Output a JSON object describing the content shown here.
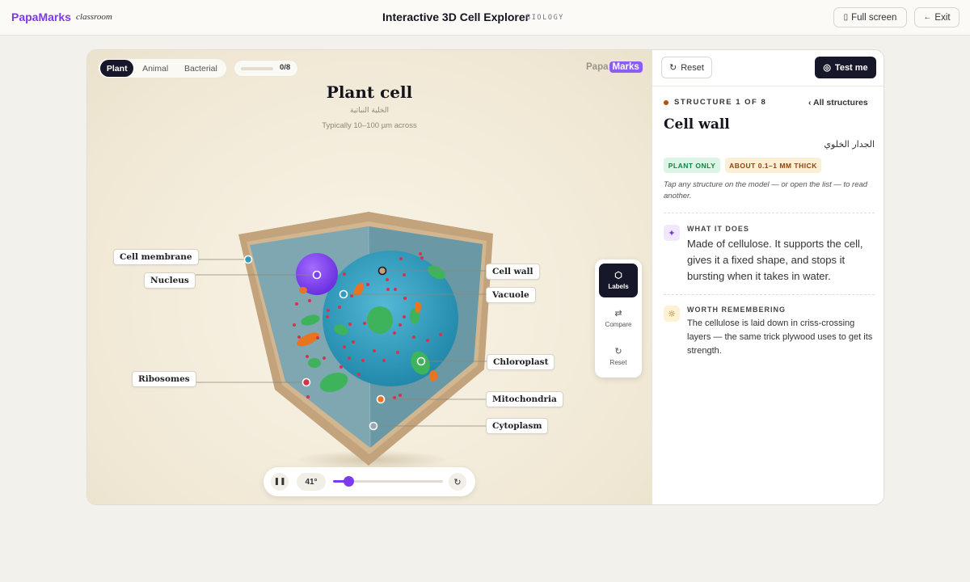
{
  "topbar": {
    "brand": "PapaMarks",
    "brand_sub": "classroom",
    "title": "Interactive 3D Cell Explorer",
    "subject": "BIOLOGY",
    "fullscreen_label": "Full screen",
    "exit_label": "Exit"
  },
  "viewer": {
    "tabs": [
      {
        "label": "Plant",
        "active": true
      },
      {
        "label": "Animal",
        "active": false
      },
      {
        "label": "Bacterial",
        "active": false
      }
    ],
    "progress": {
      "explored": 0,
      "total": 8,
      "text": "0/8"
    },
    "logo_left": "Papa",
    "logo_right": "Marks",
    "cell_title": "Plant cell",
    "cell_title_ar": "الخلية النباتية",
    "cell_size": "Typically 10–100 µm across",
    "labels": {
      "cell_membrane": "Cell membrane",
      "nucleus": "Nucleus",
      "ribosomes": "Ribosomes",
      "cell_wall": "Cell wall",
      "vacuole": "Vacuole",
      "chloroplast": "Chloroplast",
      "mitochondria": "Mitochondria",
      "cytoplasm": "Cytoplasm"
    },
    "tools": {
      "labels": "Labels",
      "compare": "Compare",
      "reset": "Reset"
    },
    "rotation": {
      "angle_text": "41°",
      "slider_fraction": 0.14
    }
  },
  "panel": {
    "reset_label": "Reset",
    "test_label": "Test me",
    "structure_count": "STRUCTURE 1 OF 8",
    "all_structures": "All structures",
    "title": "Cell wall",
    "title_ar": "الجدار الخلوي",
    "chip_scope": "PLANT ONLY",
    "chip_size": "ABOUT 0.1–1 MM THICK",
    "hint": "Tap any structure on the model — or open the list — to read another.",
    "what_head": "WHAT IT DOES",
    "what_body": "Made of cellulose. It supports the cell, gives it a fixed shape, and stops it bursting when it takes in water.",
    "remember_head": "WORTH REMEMBERING",
    "remember_body": "The cellulose is laid down in criss-crossing layers — the same trick plywood uses to get its strength."
  },
  "colors": {
    "accent": "#7c3aed",
    "dark": "#17172a",
    "cell_wall": "#c2a37c",
    "cytoplasm": "#6f9caa",
    "vacuole": "#2f9cbc",
    "nucleus": "#7b3ff0",
    "chloroplast": "#3fb25c",
    "mitochondria": "#e8741f",
    "ribosome": "#d6334a"
  },
  "icons": {
    "fullscreen": "screen-icon",
    "exit": "arrow-left-icon",
    "labels": "tag-icon",
    "compare": "swap-arrows-icon",
    "reset": "refresh-icon",
    "pause": "pause-icon",
    "test": "check-circle-icon",
    "what": "sparkle-icon",
    "remember": "sun-icon"
  }
}
